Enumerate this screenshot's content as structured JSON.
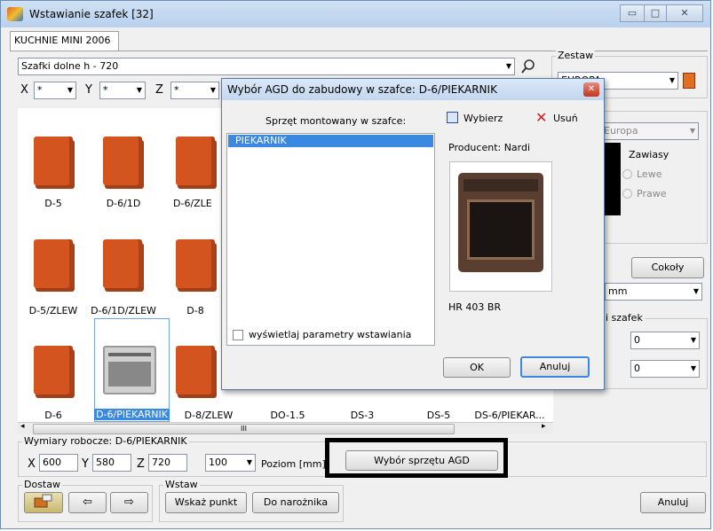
{
  "window": {
    "title": "Wstawianie szafek [32]"
  },
  "tab": {
    "label": "KUCHNIE MINI 2006"
  },
  "category": {
    "value": "Szafki dolne h - 720"
  },
  "dims": {
    "x_label": "X",
    "y_label": "Y",
    "z_label": "Z",
    "x_val": "*",
    "y_val": "*",
    "z_val": "*"
  },
  "zestaw": {
    "label": "Zestaw",
    "value": "EUROPA"
  },
  "right_panel": {
    "front": "Europa",
    "zawiasy": "Zawiasy",
    "lewe": "Lewe",
    "prawe": "Prawe",
    "cokoly": "Cokoły",
    "unit": "mm",
    "szafek": "i szafek",
    "val1": "0",
    "val2": "0"
  },
  "cabinets": {
    "row1": [
      "D-5",
      "D-6/1D",
      "D-6/ZLE"
    ],
    "row2": [
      "D-5/ZLEW",
      "D-6/1D/ZLEW",
      "D-8"
    ],
    "row3": [
      "D-6",
      "D-6/PIEKARNIK",
      "D-8/ZLEW",
      "DO-1.5",
      "DS-3",
      "DS-5",
      "DS-6/PIEKAR..."
    ]
  },
  "scrollbar": {
    "thumb": "III"
  },
  "wymiary": {
    "label": "Wymiary robocze: D-6/PIEKARNIK",
    "x_label": "X",
    "x": "600",
    "y_label": "Y",
    "y": "580",
    "z_label": "Z",
    "z": "720",
    "poziom_val": "100",
    "poziom_label": "Poziom [mm]"
  },
  "agd_button": "Wybór sprzętu AGD",
  "dostaw": {
    "label": "Dostaw",
    "left": "⇦",
    "right": "⇨"
  },
  "wstaw": {
    "label": "Wstaw",
    "point": "Wskaż punkt",
    "corner": "Do narożnika"
  },
  "cancel_main": "Anuluj",
  "dialog": {
    "title": "Wybór AGD do zabudowy w szafce: D-6/PIEKARNIK",
    "list_header": "Sprzęt montowany w szafce:",
    "select_btn": "Wybierz",
    "remove_btn": "Usuń",
    "items": [
      "PIEKARNIK"
    ],
    "producer": "Producent: Nardi",
    "model": "HR 403 BR",
    "checkbox_label": "wyświetlaj parametry wstawiania",
    "ok": "OK",
    "cancel": "Anuluj"
  }
}
